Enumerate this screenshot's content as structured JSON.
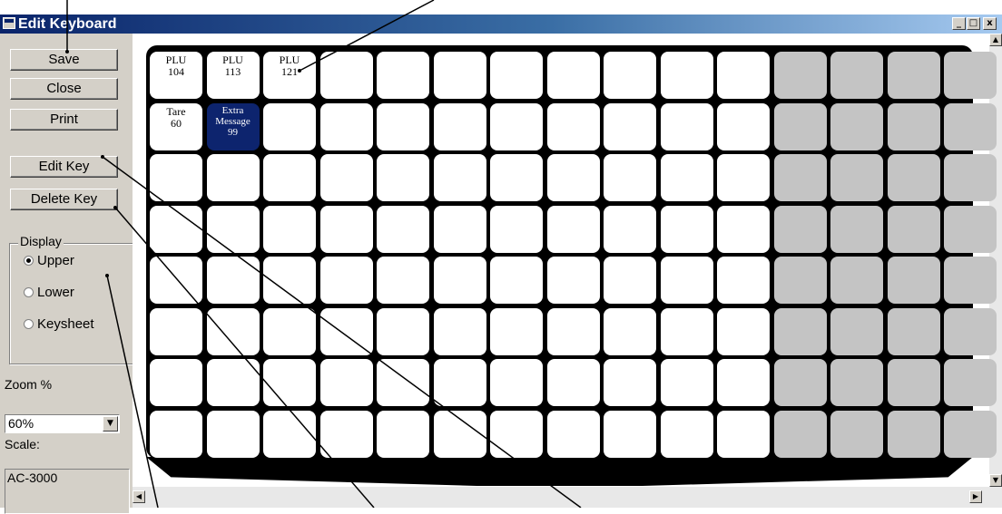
{
  "window": {
    "title": "Edit Keyboard"
  },
  "titlebar_buttons": {
    "minimize": "_",
    "maximize": "□",
    "close": "x"
  },
  "buttons": {
    "save": "Save",
    "close": "Close",
    "print": "Print",
    "edit_key": "Edit Key",
    "delete_key": "Delete Key"
  },
  "display": {
    "label": "Display",
    "options": [
      {
        "label": "Upper",
        "selected": true
      },
      {
        "label": "Lower",
        "selected": false
      },
      {
        "label": "Keysheet",
        "selected": false
      }
    ]
  },
  "zoom": {
    "label": "Zoom %",
    "value": "60%"
  },
  "scale": {
    "label": "Scale:",
    "value": "AC-3000"
  },
  "keyboard": {
    "columns": 15,
    "rows": 8,
    "active_columns": 11,
    "keys": [
      {
        "row": 0,
        "col": 0,
        "line1": "PLU",
        "line2": "104",
        "line3": ""
      },
      {
        "row": 0,
        "col": 1,
        "line1": "PLU",
        "line2": "113",
        "line3": ""
      },
      {
        "row": 0,
        "col": 2,
        "line1": "PLU",
        "line2": "121",
        "line3": ""
      },
      {
        "row": 1,
        "col": 0,
        "line1": "Tare",
        "line2": "60",
        "line3": ""
      },
      {
        "row": 1,
        "col": 1,
        "line1": "Extra",
        "line2": "Message",
        "line3": "99",
        "selected": true
      }
    ]
  },
  "colors": {
    "selected_key": "#0d246e",
    "inactive_key": "#c4c4c4",
    "title_bar": "#0a246a"
  }
}
